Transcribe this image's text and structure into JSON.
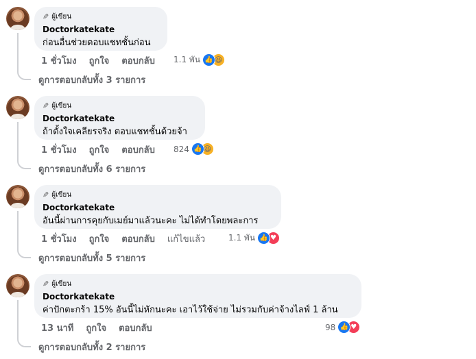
{
  "comments": [
    {
      "badge": "ผู้เขียน",
      "author": "Doctorkatekate",
      "text": "ก่อนอื่นช่วยตอบแชทชั้นก่อน",
      "time": "1 ชั่วโมง",
      "like": "ถูกใจ",
      "reply": "ตอบกลับ",
      "edited": "",
      "reaction_count": "1.1 พัน",
      "reactions": [
        "like-icon",
        "haha-icon"
      ],
      "view_replies": "ดูการตอบกลับทั้ง 3 รายการ"
    },
    {
      "badge": "ผู้เขียน",
      "author": "Doctorkatekate",
      "text": "ถ้าตั้งใจเคลียรจริง ตอบแชทชั้นด้วยจ้า",
      "time": "1 ชั่วโมง",
      "like": "ถูกใจ",
      "reply": "ตอบกลับ",
      "edited": "",
      "reaction_count": "824",
      "reactions": [
        "like-icon",
        "haha-icon"
      ],
      "view_replies": "ดูการตอบกลับทั้ง 6 รายการ"
    },
    {
      "badge": "ผู้เขียน",
      "author": "Doctorkatekate",
      "text": "อันนี้ผ่านการคุยกับเมย์มาแล้วนะคะ ไม่ได้ทำโดยพละการ",
      "time": "1 ชั่วโมง",
      "like": "ถูกใจ",
      "reply": "ตอบกลับ",
      "edited": "แก้ไขแล้ว",
      "reaction_count": "1.1 พัน",
      "reactions": [
        "like-icon",
        "love-icon"
      ],
      "view_replies": "ดูการตอบกลับทั้ง 5 รายการ"
    },
    {
      "badge": "ผู้เขียน",
      "author": "Doctorkatekate",
      "text": "ค่าปักตะกร้า 15% อันนี้ไม่หักนะคะ เอาไว้ใช้จ่าย ไม่รวมกับค่าจ้างไลฟ์ 1 ล้าน",
      "time": "13 นาที",
      "like": "ถูกใจ",
      "reply": "ตอบกลับ",
      "edited": "",
      "reaction_count": "98",
      "reactions": [
        "like-icon",
        "love-icon"
      ],
      "view_replies": "ดูการตอบกลับทั้ง 2 รายการ"
    }
  ],
  "colors": {
    "bubble": "#f0f2f5",
    "secondary_text": "#65676b",
    "like_blue": "#1877f2",
    "love_red": "#f33e58",
    "haha_yellow": "#f7b125",
    "connector": "#ced0d4"
  }
}
